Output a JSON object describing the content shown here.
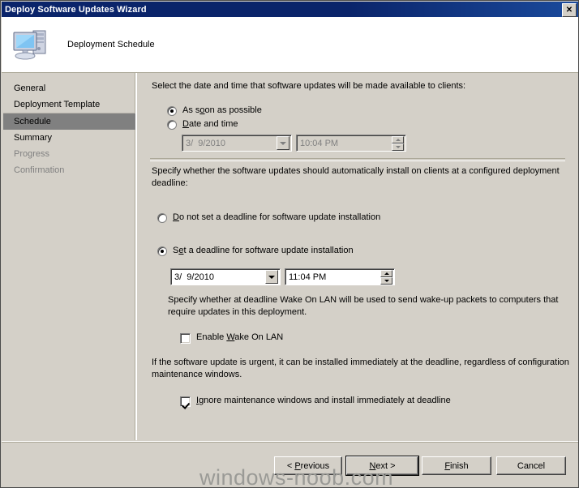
{
  "window": {
    "title": "Deploy Software Updates Wizard",
    "close_label": "✕"
  },
  "header": {
    "title": "Deployment Schedule",
    "icon": "computer-icon"
  },
  "sidebar": {
    "items": [
      {
        "label": "General",
        "state": "normal"
      },
      {
        "label": "Deployment Template",
        "state": "normal"
      },
      {
        "label": "Schedule",
        "state": "selected"
      },
      {
        "label": "Summary",
        "state": "normal"
      },
      {
        "label": "Progress",
        "state": "disabled"
      },
      {
        "label": "Confirmation",
        "state": "disabled"
      }
    ]
  },
  "main": {
    "availability_prompt": "Select the date and time that software updates will be made available to clients:",
    "radio_asap": "As soon as possible",
    "radio_asap_checked": true,
    "radio_datetime": "Date and time",
    "radio_datetime_checked": false,
    "available_date": "3/  9/2010",
    "available_time": "10:04 PM",
    "deadline_prompt_line1": "Specify whether the software updates should automatically install on clients at a configured",
    "deadline_prompt_line2": "deployment deadline:",
    "radio_no_deadline": "Do not set a deadline for software update installation",
    "radio_no_deadline_checked": false,
    "radio_set_deadline": "Set a deadline for software update installation",
    "radio_set_deadline_checked": true,
    "deadline_date": "3/  9/2010",
    "deadline_time": "11:04 PM",
    "wol_prompt_line1": "Specify whether at deadline Wake On LAN will be used to send wake-up packets to computers",
    "wol_prompt_line2": "that require updates in this deployment.",
    "checkbox_wol": "Enable Wake On LAN",
    "checkbox_wol_checked": false,
    "urgent_prompt_line1": "If the software update is urgent, it can be installed immediately at the deadline, regardless of",
    "urgent_prompt_line2": "configuration maintenance windows.",
    "checkbox_ignore": "Ignore maintenance windows and install immediately at deadline",
    "checkbox_ignore_checked": true
  },
  "footer": {
    "previous_label": "< Previous",
    "next_label": "Next >",
    "finish_label": "Finish",
    "cancel_label": "Cancel"
  },
  "watermark": {
    "text": "windows-noob.com"
  },
  "colors": {
    "titlebar": "#0a246a",
    "face": "#d4d0c8",
    "selected": "#808080",
    "disabled_text": "#808080",
    "watermark": "#9a9a96"
  }
}
